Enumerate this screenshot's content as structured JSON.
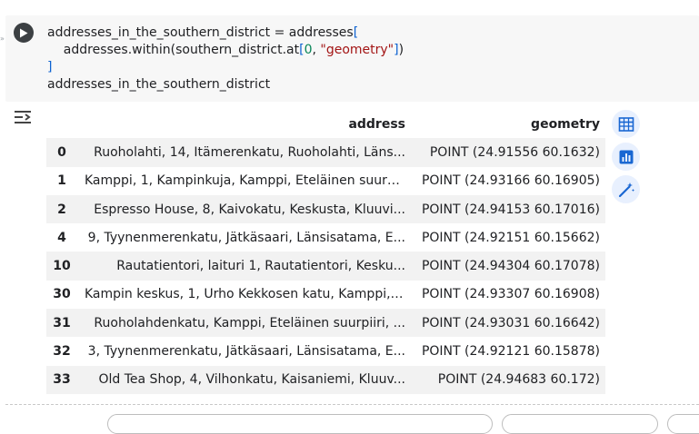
{
  "code_cell": {
    "line1_var": "addresses_in_the_southern_district",
    "line1_op": " = addresses",
    "line1_bracket": "[",
    "line2_indent": "    addresses.within(southern_district.at",
    "line2_bracket_open": "[",
    "line2_num": "0",
    "line2_comma": ", ",
    "line2_str": "\"geometry\"",
    "line2_bracket_close": "]",
    "line2_paren": ")",
    "line3_bracket": "]",
    "line4": "addresses_in_the_southern_district"
  },
  "table": {
    "columns": [
      "",
      "address",
      "geometry"
    ],
    "rows": [
      {
        "index": "0",
        "address": "Ruoholahti, 14, Itämerenkatu, Ruoholahti, Läns...",
        "geometry": "POINT (24.91556 60.1632)"
      },
      {
        "index": "1",
        "address": "Kamppi, 1, Kampinkuja, Kamppi, Eteläinen suurp...",
        "geometry": "POINT (24.93166 60.16905)"
      },
      {
        "index": "2",
        "address": "Espresso House, 8, Kaivokatu, Keskusta, Kluuvi...",
        "geometry": "POINT (24.94153 60.17016)"
      },
      {
        "index": "4",
        "address": "9, Tyynenmerenkatu, Jätkäsaari, Länsisatama, E...",
        "geometry": "POINT (24.92151 60.15662)"
      },
      {
        "index": "10",
        "address": "Rautatientori, laituri 1, Rautatientori, Kesku...",
        "geometry": "POINT (24.94304 60.17078)"
      },
      {
        "index": "30",
        "address": "Kampin keskus, 1, Urho Kekkosen katu, Kamppi, ...",
        "geometry": "POINT (24.93307 60.16908)"
      },
      {
        "index": "31",
        "address": "Ruoholahdenkatu, Kamppi, Eteläinen suurpiiri, ...",
        "geometry": "POINT (24.93031 60.16642)"
      },
      {
        "index": "32",
        "address": "3, Tyynenmerenkatu, Jätkäsaari, Länsisatama, E...",
        "geometry": "POINT (24.92121 60.15878)"
      },
      {
        "index": "33",
        "address": "Old Tea Shop, 4, Vilhonkatu, Kaisaniemi, Kluuv...",
        "geometry": "POINT (24.94683 60.172)"
      }
    ]
  },
  "icons": {
    "run": "play-icon",
    "output_toggle": "output-toggle-icon",
    "table_view": "table-icon",
    "chart": "bar-chart-icon",
    "magic": "magic-wand-icon"
  },
  "colors": {
    "bracket": "#0c62d1",
    "number": "#098658",
    "string": "#a31515",
    "side_button_bg": "#e8f0fe",
    "side_button_icon": "#1967d2"
  }
}
